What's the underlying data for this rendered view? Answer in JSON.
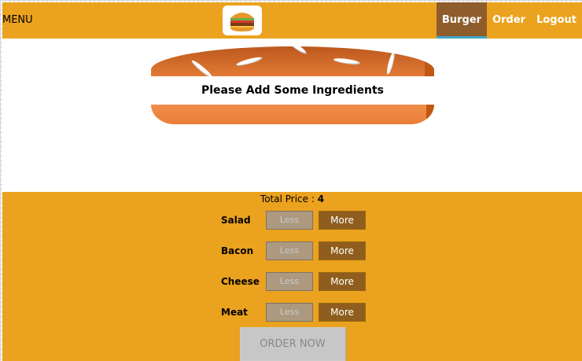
{
  "toolbar": {
    "menu_label": "MENU",
    "nav": [
      {
        "label": "Burger",
        "active": true
      },
      {
        "label": "Order",
        "active": false
      },
      {
        "label": "Logout",
        "active": false
      }
    ]
  },
  "burger": {
    "message": "Please Add Some Ingredients"
  },
  "controls": {
    "total_label": "Total Price :",
    "total_value": "4",
    "items": [
      {
        "label": "Salad",
        "less": "Less",
        "more": "More"
      },
      {
        "label": "Bacon",
        "less": "Less",
        "more": "More"
      },
      {
        "label": "Cheese",
        "less": "Less",
        "more": "More"
      },
      {
        "label": "Meat",
        "less": "Less",
        "more": "More"
      }
    ],
    "order_button": "ORDER NOW"
  },
  "colors": {
    "toolbar": "#eba21f",
    "active_nav": "#8f5c2c",
    "more_button": "#8f5e1e",
    "less_button": "#ac9980",
    "bread": "#e27b36"
  }
}
